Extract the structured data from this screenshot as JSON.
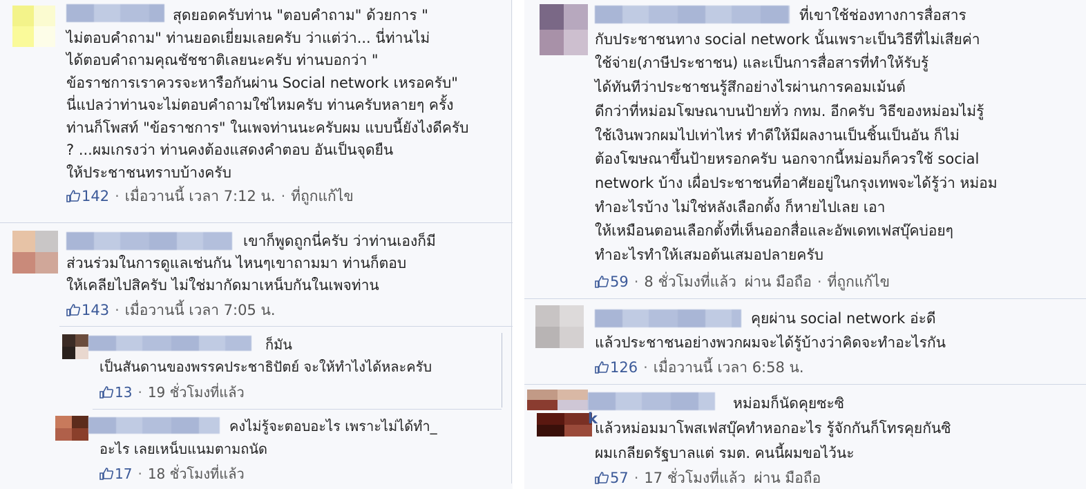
{
  "colors": {
    "link": "#3b5998",
    "meta": "#555555",
    "background": "#f7f8fb",
    "separator": "#cfd6e4"
  },
  "like_icon": "thumbs-up-icon",
  "comments": [
    {
      "body": "สุดยอดครับท่าน \"ตอบคำถาม\" ด้วยการ \"\nไม่ตอบคำถาม\" ท่านยอดเยี่ยมเลยครับ ว่าแต่ว่า... นี่ท่านไม่\nได้ตอบคำถามคุณชัชชาติเลยนะครับ ท่านบอกว่า \"\nข้อราชการเราควรจะหารือกันผ่าน Social network เหรอครับ\"\nนี่แปลว่าท่านจะไม่ตอบคำถามใช่ไหมครับ ท่านครับหลายๆ ครั้ง\nท่านก็โพสท์ \"ข้อราชการ\" ในเพจท่านนะครับผม แบบนี้ยังไงดีครับ\n? ...ผมเกรงว่า ท่านคงต้องแสดงคำตอบ อันเป็นจุดยืน\nให้ประชาชนทราบบ้างครับ",
      "likes": "142",
      "time": "เมื่อวานนี้ เวลา 7:12 น.",
      "edited": "ที่ถูกแก้ไข"
    },
    {
      "body": "เขาก็พูดถูกนี่ครับ ว่าท่านเองก็มี\nส่วนร่วมในการดูแลเช่นกัน ไหนๆเขาถามมา ท่านก็ตอบ\nให้เคลียไปสิครับ ไม่ใช่มากัดมาเหน็บกันในเพจท่าน",
      "likes": "143",
      "time": "เมื่อวานนี้ เวลา 7:05 น."
    },
    {
      "body": "ก็มัน\nเป็นสันดานของพรรคประชาธิปัตย์ จะให้ทำไงได้หละครับ",
      "likes": "13",
      "time": "19 ชั่วโมงที่แล้ว"
    },
    {
      "body": "คงไม่รู้จะตอบอะไร เพราะไม่ได้ทำ_\nอะไร เลยเหน็บแนมตามถนัด",
      "likes": "17",
      "time": "18 ชั่วโมงที่แล้ว"
    },
    {
      "body": "ที่เขาใช้ช่องทางการสื่อสาร\nกับประชาชนทาง social network นั้นเพราะเป็นวิธีที่ไม่เสียค่า\nใช้จ่าย(ภาษีประชาชน) และเป็นการสื่อสารที่ทำให้รับรู้\nได้ทันทีว่าประชาชนรู้สึกอย่างไรผ่านการคอมเม้นต์\nดีกว่าที่หม่อมโฆษณาบนป้ายทั่ว กทม. อีกครับ วิธีของหม่อมไม่รู้\nใช้เงินพวกผมไปเท่าไหร่ ทำดีให้มีผลงานเป็นชิ้นเป็นอัน ก็ไม่\nต้องโฆษณาขึ้นป้ายหรอกครับ นอกจากนี้หม่อมก็ควรใช้ social\nnetwork บ้าง เผื่อประชาชนที่อาศัยอยู่ในกรุงเทพจะได้รู้ว่า หม่อม\nทำอะไรบ้าง ไม่ใช่หลังเลือกตั้ง ก็หายไปเลย เอา\nให้เหมือนตอนเลือกตั้งที่เห็นออกสื่อและอัพเดทเฟสบุ๊คบ่อยๆ\nทำอะไรทำให้เสมอต้นเสมอปลายครับ",
      "likes": "59",
      "time": "8 ชั่วโมงที่แล้ว",
      "via": "ผ่าน มือถือ",
      "edited": "ที่ถูกแก้ไข"
    },
    {
      "body": "คุยผ่าน social network อ่ะดี\nแล้วประชาชนอย่างพวกผมจะได้รู้บ้างว่าคิดจะทำอะไรกัน",
      "likes": "126",
      "time": "เมื่อวานนี้ เวลา 6:58 น."
    },
    {
      "name_tail": "k",
      "body": "หม่อมก็นัดคุยซะซิ\nแล้วหม่อมมาโพสเฟสบุ๊คทำหอกอะไร รู้จักกันก็โทรคุยกันซิ\nผมเกลียดรัฐบาลแต่ รมต. คนนี้ผมขอไว้นะ",
      "likes": "57",
      "time": "17 ชั่วโมงที่แล้ว",
      "via": "ผ่าน มือถือ"
    }
  ]
}
